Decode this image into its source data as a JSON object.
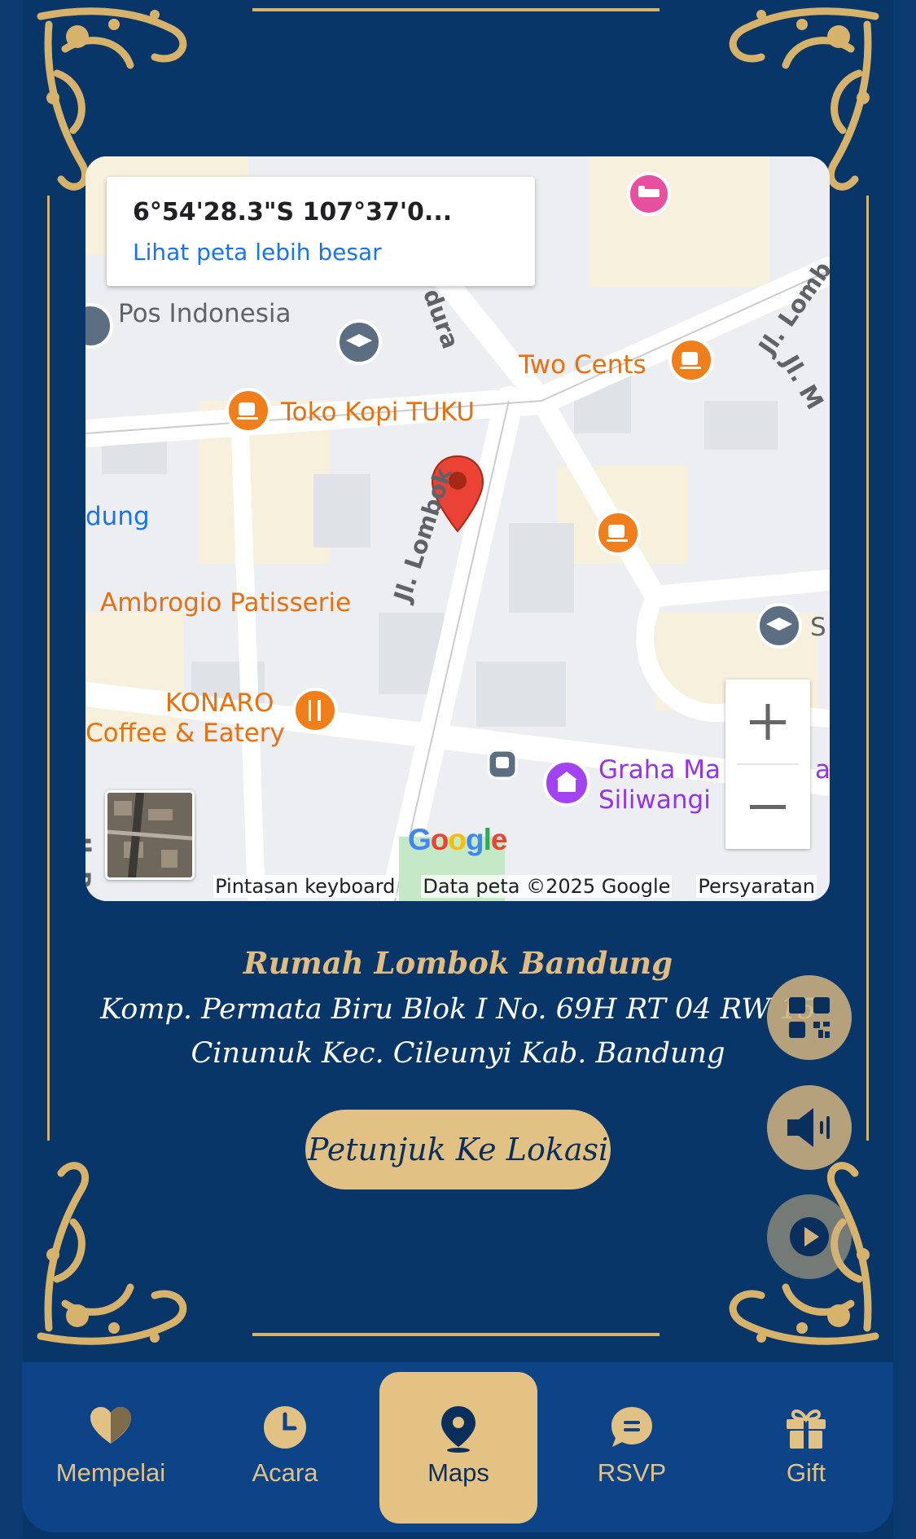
{
  "map": {
    "coordinates": "6°54'28.3\"S 107°37'0...",
    "view_larger_link": "Lihat peta lebih besar",
    "google_logo": "Google",
    "keyboard_shortcuts": "Pintasan keyboard",
    "map_data": "Data peta ©2025 Google",
    "terms": "Persyaratan",
    "pois": {
      "pos_indonesia": "Pos Indonesia",
      "two_cents": "Two Cents",
      "toko_kopi_tuku": "Toko Kopi TUKU",
      "ambrogio": "Ambrogio Patisserie",
      "konaro_line1": "KONARO",
      "konaro_line2": "Coffee & Eatery",
      "graha_line1": "Graha Ma",
      "graha_line1_end": "a",
      "graha_line2": "Siliwangi",
      "partial_dung": "dung",
      "partial_s": "S"
    },
    "streets": {
      "jl_lombok": "Jl. Lombok",
      "jl_lomb_top": "Jl. Lomb",
      "jl_m": "Jl. M",
      "dura": "dura",
      "jl_ba": "Jl. Ba"
    }
  },
  "venue": {
    "name": "Rumah Lombok Bandung",
    "address_line1": "Komp. Permata Biru Blok I No. 69H RT 04 RW 15",
    "address_line2": "Cinunuk Kec. Cileunyi Kab. Bandung"
  },
  "directions_button": "Petunjuk Ke Lokasi",
  "floating_buttons": [
    "qr-code-icon",
    "speaker-icon",
    "play-icon"
  ],
  "nav": {
    "items": [
      {
        "label": "Mempelai",
        "icon": "heart-icon"
      },
      {
        "label": "Acara",
        "icon": "clock-icon"
      },
      {
        "label": "Maps",
        "icon": "map-pin-icon",
        "active": true
      },
      {
        "label": "RSVP",
        "icon": "chat-icon"
      },
      {
        "label": "Gift",
        "icon": "gift-icon"
      }
    ]
  },
  "colors": {
    "background": "#083669",
    "gold": "#e2c184",
    "nav_bg": "#0d4488",
    "marker_red": "#ea4335",
    "poi_orange": "#e8700f"
  }
}
